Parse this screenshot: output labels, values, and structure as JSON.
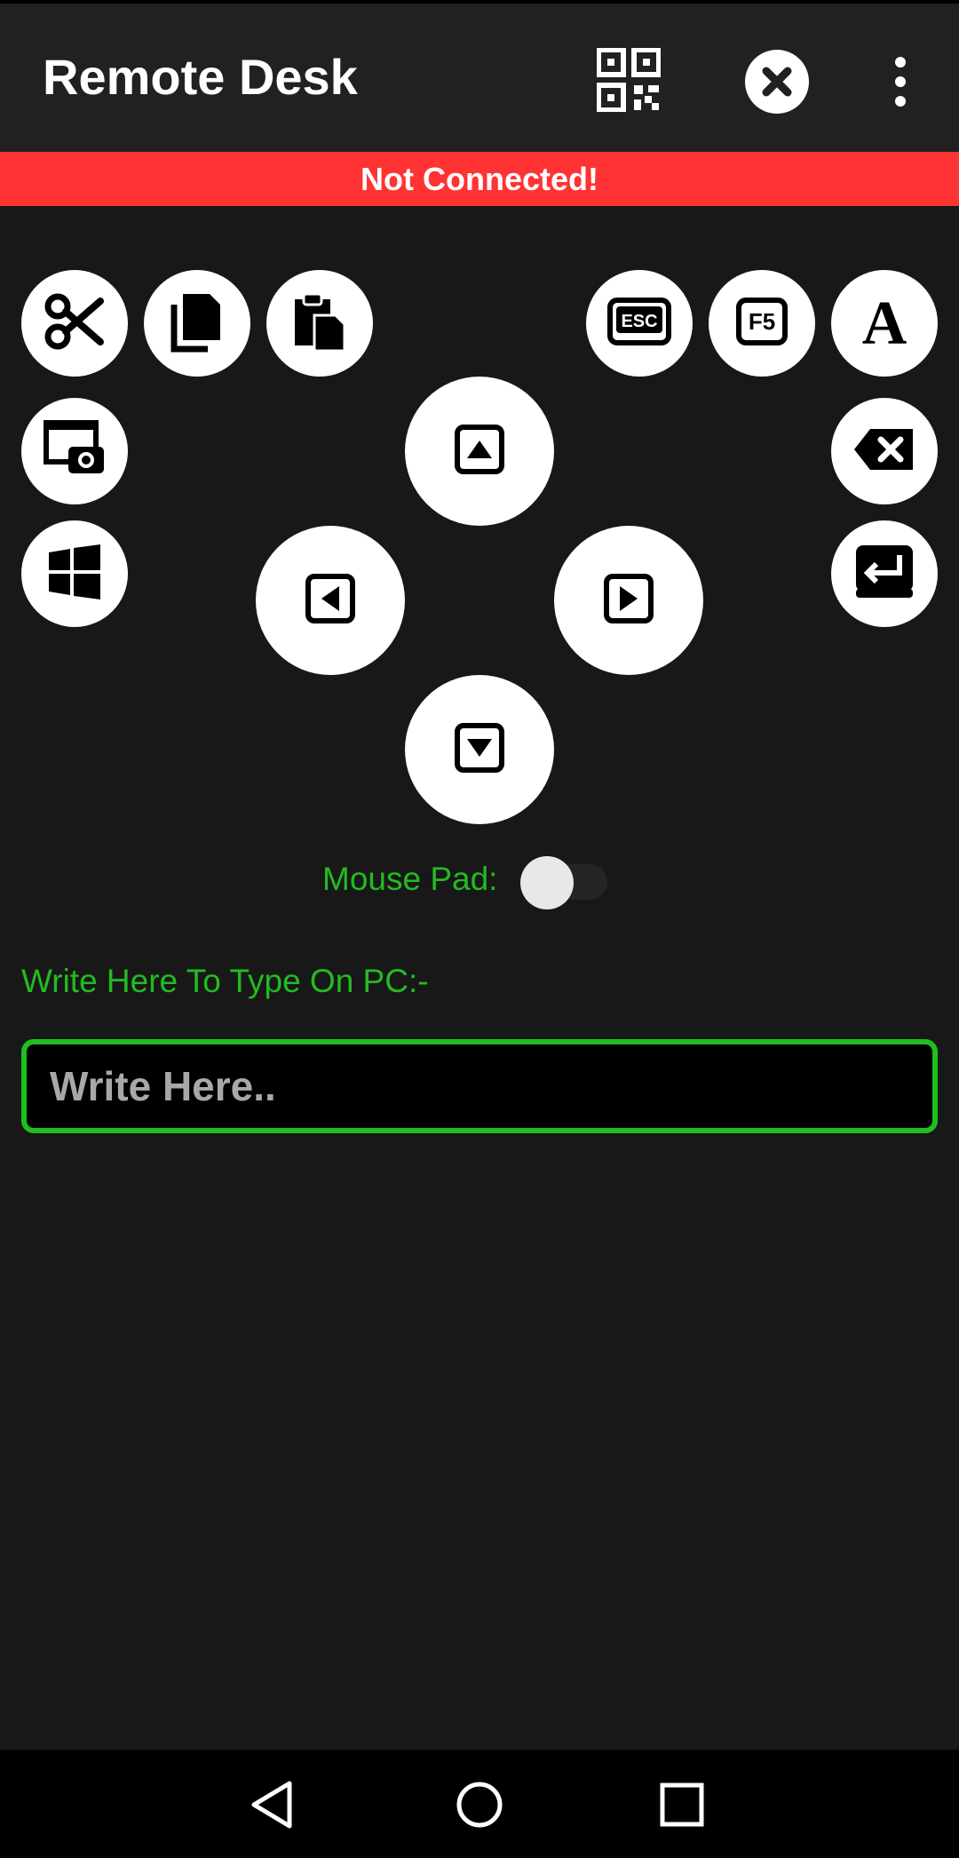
{
  "app_bar": {
    "title": "Remote Desk",
    "icons": [
      "qr-code-icon",
      "close-icon",
      "more-vert-icon"
    ]
  },
  "status": {
    "text": "Not Connected!",
    "color": "#ff3333"
  },
  "controls": {
    "left_column": [
      "cut-icon",
      "copy-icon",
      "paste-icon",
      "screenshot-icon",
      "windows-icon"
    ],
    "right_column": [
      "esc-icon",
      "f5-icon",
      "font-icon",
      "backspace-icon",
      "enter-icon"
    ],
    "dpad": [
      "arrow-up-icon",
      "arrow-left-icon",
      "arrow-right-icon",
      "arrow-down-icon"
    ]
  },
  "mouse_pad": {
    "label": "Mouse Pad:",
    "enabled": false
  },
  "typing": {
    "label": "Write Here To Type On PC:-",
    "placeholder": "Write Here..",
    "value": ""
  },
  "colors": {
    "accent": "#22bb22",
    "background": "#181818",
    "app_bar": "#212121"
  },
  "nav_bar": {
    "icons": [
      "back-icon",
      "home-icon",
      "recents-icon"
    ]
  }
}
